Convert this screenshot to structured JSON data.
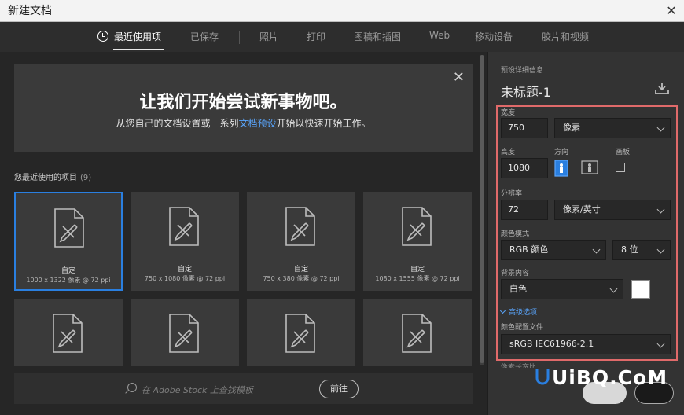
{
  "window": {
    "title": "新建文档",
    "close_glyph": "✕"
  },
  "tabs": [
    {
      "label": "最近使用项",
      "active": true,
      "icon": "clock-icon"
    },
    {
      "label": "已保存"
    },
    {
      "label": "照片"
    },
    {
      "label": "打印"
    },
    {
      "label": "图稿和插图"
    },
    {
      "label": "Web"
    },
    {
      "label": "移动设备"
    },
    {
      "label": "胶片和视频"
    }
  ],
  "banner": {
    "title": "让我们开始尝试新事物吧。",
    "sub_before": "从您自己的文档设置或一系列",
    "sub_link": "文档预设",
    "sub_after": "开始以快速开始工作。",
    "close_glyph": "✕"
  },
  "recent": {
    "label": "您最近使用的项目",
    "count": "(9)",
    "items": [
      {
        "name": "自定",
        "size": "1000 x 1322 像素 @ 72 ppi",
        "selected": true
      },
      {
        "name": "自定",
        "size": "750 x 1080 像素 @ 72 ppi"
      },
      {
        "name": "自定",
        "size": "750 x 380 像素 @ 72 ppi"
      },
      {
        "name": "自定",
        "size": "1080 x 1555 像素 @ 72 ppi"
      }
    ]
  },
  "stock": {
    "placeholder": "在 Adobe Stock 上查找模板",
    "go_label": "前往"
  },
  "details": {
    "header": "预设详细信息",
    "doc_title": "未标题-1",
    "width_label": "宽度",
    "width_value": "750",
    "width_unit": "像素",
    "height_label": "高度",
    "height_value": "1080",
    "orientation_label": "方向",
    "artboard_label": "画板",
    "resolution_label": "分辨率",
    "resolution_value": "72",
    "resolution_unit": "像素/英寸",
    "color_mode_label": "颜色模式",
    "color_mode_value": "RGB 颜色",
    "bit_depth_value": "8 位",
    "background_label": "背景内容",
    "background_value": "白色",
    "background_swatch": "#ffffff",
    "advanced_label": "高级选项",
    "color_profile_label": "颜色配置文件",
    "color_profile_value": "sRGB IEC61966-2.1",
    "pixel_aspect_label": "像素长宽比"
  },
  "watermark": {
    "text": "UiBQ.CoM"
  },
  "colors": {
    "accent": "#2a7fe0",
    "highlight": "#e06a6a",
    "link": "#5aa7ff"
  }
}
